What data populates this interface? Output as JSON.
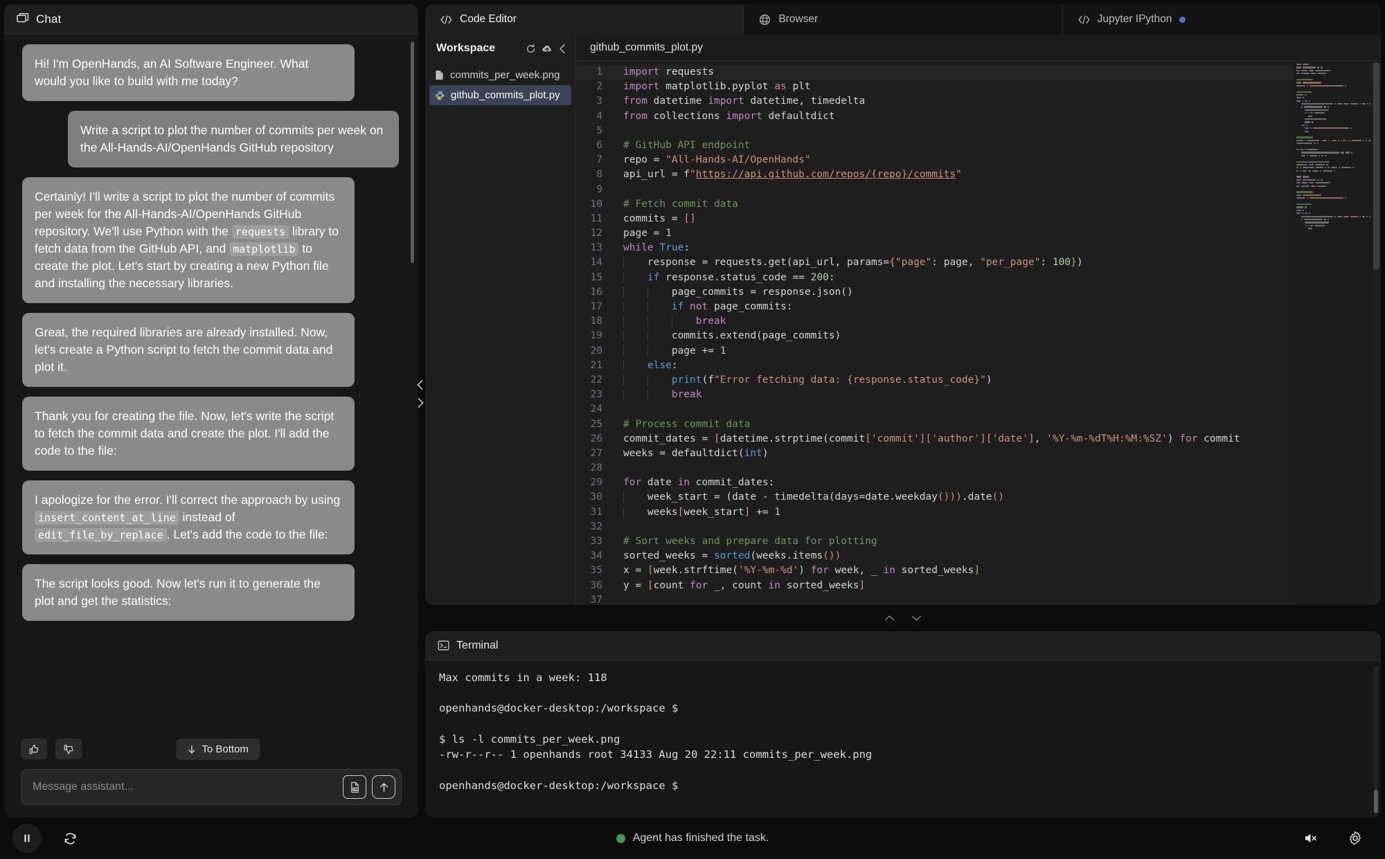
{
  "chat": {
    "header_title": "Chat",
    "header_icon": "chat-bubble-icon",
    "messages": [
      {
        "role": "assistant",
        "text": "Hi! I'm OpenHands, an AI Software Engineer. What would you like to build with me today?"
      },
      {
        "role": "user",
        "text": "Write a script to plot the number of commits per week on the All-Hands-AI/OpenHands GitHub repository"
      },
      {
        "role": "assistant",
        "text": "Certainly! I'll write a script to plot the number of commits per week for the All-Hands-AI/OpenHands GitHub repository. We'll use Python with the ",
        "code1": "requests",
        "text2": " library to fetch data from the GitHub API, and ",
        "code2": "matplotlib",
        "text3": " to create the plot. Let's start by creating a new Python file and installing the necessary libraries."
      },
      {
        "role": "assistant",
        "text": "Great, the required libraries are already installed. Now, let's create a Python script to fetch the commit data and plot it."
      },
      {
        "role": "assistant",
        "text": "Thank you for creating the file. Now, let's write the script to fetch the commit data and create the plot. I'll add the code to the file:"
      },
      {
        "role": "assistant",
        "text": "I apologize for the error. I'll correct the approach by using ",
        "code1": "insert_content_at_line",
        "text2": " instead of ",
        "code2": "edit_file_by_replace",
        "text3": ". Let's add the code to the file:"
      },
      {
        "role": "assistant",
        "text": "The script looks good. Now let's run it to generate the plot and get the statistics:"
      }
    ],
    "thumbs_up_icon": "thumbs-up-icon",
    "thumbs_down_icon": "thumbs-down-icon",
    "to_bottom_label": "To Bottom",
    "to_bottom_arrow": "arrow-down-icon",
    "input_placeholder": "Message assistant...",
    "input_value": "",
    "attach_icon": "attach-image-icon",
    "send_icon": "send-arrow-up-icon"
  },
  "tabs": [
    {
      "label": "Code Editor",
      "icon": "code-brackets-icon",
      "active": true,
      "dot": false
    },
    {
      "label": "Browser",
      "icon": "globe-icon",
      "active": false,
      "dot": false
    },
    {
      "label": "Jupyter IPython",
      "icon": "code-brackets-icon",
      "active": false,
      "dot": true
    }
  ],
  "tab_dot_color": "#4b74d4",
  "workspace": {
    "title": "Workspace",
    "refresh_icon": "refresh-icon",
    "upload_icon": "cloud-upload-icon",
    "collapse_icon": "chevron-left-icon",
    "files": [
      {
        "name": "commits_per_week.png",
        "icon": "file-icon",
        "selected": false
      },
      {
        "name": "github_commits_plot.py",
        "icon": "python-icon",
        "selected": true
      }
    ]
  },
  "editor": {
    "filename": "github_commits_plot.py",
    "current_line": 1,
    "total_lines_shown": 37,
    "lines": [
      {
        "n": 1,
        "indent": 0,
        "tokens": [
          {
            "t": "import",
            "c": "kw2"
          },
          {
            "t": " requests",
            "c": "op"
          }
        ]
      },
      {
        "n": 2,
        "indent": 0,
        "tokens": [
          {
            "t": "import",
            "c": "kw2"
          },
          {
            "t": " matplotlib.pyplot ",
            "c": "op"
          },
          {
            "t": "as",
            "c": "kw2"
          },
          {
            "t": " plt",
            "c": "op"
          }
        ]
      },
      {
        "n": 3,
        "indent": 0,
        "tokens": [
          {
            "t": "from",
            "c": "kw2"
          },
          {
            "t": " datetime ",
            "c": "op"
          },
          {
            "t": "import",
            "c": "kw2"
          },
          {
            "t": " datetime, timedelta",
            "c": "op"
          }
        ]
      },
      {
        "n": 4,
        "indent": 0,
        "tokens": [
          {
            "t": "from",
            "c": "kw2"
          },
          {
            "t": " collections ",
            "c": "op"
          },
          {
            "t": "import",
            "c": "kw2"
          },
          {
            "t": " defaultdict",
            "c": "op"
          }
        ]
      },
      {
        "n": 5,
        "indent": 0,
        "tokens": []
      },
      {
        "n": 6,
        "indent": 0,
        "tokens": [
          {
            "t": "# GitHub API endpoint",
            "c": "cmt"
          }
        ]
      },
      {
        "n": 7,
        "indent": 0,
        "tokens": [
          {
            "t": "repo = ",
            "c": "op"
          },
          {
            "t": "\"All-Hands-AI/OpenHands\"",
            "c": "str"
          }
        ]
      },
      {
        "n": 8,
        "indent": 0,
        "tokens": [
          {
            "t": "api_url = f",
            "c": "op"
          },
          {
            "t": "\"",
            "c": "str"
          },
          {
            "t": "https://api.github.com/repos/{repo}/commits",
            "c": "lnk"
          },
          {
            "t": "\"",
            "c": "str"
          }
        ]
      },
      {
        "n": 9,
        "indent": 0,
        "tokens": []
      },
      {
        "n": 10,
        "indent": 0,
        "tokens": [
          {
            "t": "# Fetch commit data",
            "c": "cmt"
          }
        ]
      },
      {
        "n": 11,
        "indent": 0,
        "tokens": [
          {
            "t": "commits = ",
            "c": "op"
          },
          {
            "t": "[]",
            "c": "str"
          }
        ]
      },
      {
        "n": 12,
        "indent": 0,
        "tokens": [
          {
            "t": "page = ",
            "c": "op"
          },
          {
            "t": "1",
            "c": "num"
          }
        ]
      },
      {
        "n": 13,
        "indent": 0,
        "tokens": [
          {
            "t": "while",
            "c": "kw2"
          },
          {
            "t": " ",
            "c": "op"
          },
          {
            "t": "True",
            "c": "kw"
          },
          {
            "t": ":",
            "c": "op"
          }
        ]
      },
      {
        "n": 14,
        "indent": 1,
        "tokens": [
          {
            "t": "response = requests.get(api_url, params=",
            "c": "op"
          },
          {
            "t": "{",
            "c": "str"
          },
          {
            "t": "\"page\"",
            "c": "str"
          },
          {
            "t": ": page, ",
            "c": "op"
          },
          {
            "t": "\"per_page\"",
            "c": "str"
          },
          {
            "t": ": ",
            "c": "op"
          },
          {
            "t": "100",
            "c": "num"
          },
          {
            "t": "}",
            "c": "str"
          },
          {
            "t": ")",
            "c": "op"
          }
        ]
      },
      {
        "n": 15,
        "indent": 1,
        "tokens": [
          {
            "t": "if",
            "c": "kw"
          },
          {
            "t": " response.status_code == ",
            "c": "op"
          },
          {
            "t": "200",
            "c": "num"
          },
          {
            "t": ":",
            "c": "op"
          }
        ]
      },
      {
        "n": 16,
        "indent": 2,
        "tokens": [
          {
            "t": "page_commits = response.json()",
            "c": "op"
          }
        ]
      },
      {
        "n": 17,
        "indent": 2,
        "tokens": [
          {
            "t": "if",
            "c": "kw"
          },
          {
            "t": " ",
            "c": "op"
          },
          {
            "t": "not",
            "c": "kw2"
          },
          {
            "t": " page_commits:",
            "c": "op"
          }
        ]
      },
      {
        "n": 18,
        "indent": 3,
        "tokens": [
          {
            "t": "break",
            "c": "kw2"
          }
        ]
      },
      {
        "n": 19,
        "indent": 2,
        "tokens": [
          {
            "t": "commits.extend(page_commits)",
            "c": "op"
          }
        ]
      },
      {
        "n": 20,
        "indent": 2,
        "tokens": [
          {
            "t": "page += ",
            "c": "op"
          },
          {
            "t": "1",
            "c": "num"
          }
        ]
      },
      {
        "n": 21,
        "indent": 1,
        "tokens": [
          {
            "t": "else",
            "c": "kw"
          },
          {
            "t": ":",
            "c": "op"
          }
        ]
      },
      {
        "n": 22,
        "indent": 2,
        "tokens": [
          {
            "t": "print",
            "c": "kw"
          },
          {
            "t": "(f",
            "c": "op"
          },
          {
            "t": "\"Error fetching data: {response.status_code}\"",
            "c": "str"
          },
          {
            "t": ")",
            "c": "op"
          }
        ]
      },
      {
        "n": 23,
        "indent": 2,
        "tokens": [
          {
            "t": "break",
            "c": "kw2"
          }
        ]
      },
      {
        "n": 24,
        "indent": 0,
        "tokens": []
      },
      {
        "n": 25,
        "indent": 0,
        "tokens": [
          {
            "t": "# Process commit data",
            "c": "cmt"
          }
        ]
      },
      {
        "n": 26,
        "indent": 0,
        "tokens": [
          {
            "t": "commit_dates = ",
            "c": "op"
          },
          {
            "t": "[",
            "c": "str"
          },
          {
            "t": "datetime.strptime(commit",
            "c": "op"
          },
          {
            "t": "[",
            "c": "str"
          },
          {
            "t": "'commit'",
            "c": "str"
          },
          {
            "t": "]",
            "c": "str"
          },
          {
            "t": "[",
            "c": "str"
          },
          {
            "t": "'author'",
            "c": "str"
          },
          {
            "t": "]",
            "c": "str"
          },
          {
            "t": "[",
            "c": "str"
          },
          {
            "t": "'date'",
            "c": "str"
          },
          {
            "t": "]",
            "c": "str"
          },
          {
            "t": ", ",
            "c": "op"
          },
          {
            "t": "'%Y-%m-%dT%H:%M:%SZ'",
            "c": "str"
          },
          {
            "t": ") ",
            "c": "op"
          },
          {
            "t": "for",
            "c": "kw2"
          },
          {
            "t": " commit",
            "c": "op"
          }
        ]
      },
      {
        "n": 27,
        "indent": 0,
        "tokens": [
          {
            "t": "weeks = defaultdict(",
            "c": "op"
          },
          {
            "t": "int",
            "c": "kw"
          },
          {
            "t": ")",
            "c": "op"
          }
        ]
      },
      {
        "n": 28,
        "indent": 0,
        "tokens": []
      },
      {
        "n": 29,
        "indent": 0,
        "tokens": [
          {
            "t": "for",
            "c": "kw2"
          },
          {
            "t": " date ",
            "c": "op"
          },
          {
            "t": "in",
            "c": "kw2"
          },
          {
            "t": " commit_dates:",
            "c": "op"
          }
        ]
      },
      {
        "n": 30,
        "indent": 1,
        "tokens": [
          {
            "t": "week_start = (date - timedelta(days=date.weekday",
            "c": "op"
          },
          {
            "t": "()))",
            "c": "str"
          },
          {
            "t": ".date",
            "c": "op"
          },
          {
            "t": "()",
            "c": "str"
          }
        ]
      },
      {
        "n": 31,
        "indent": 1,
        "tokens": [
          {
            "t": "weeks",
            "c": "op"
          },
          {
            "t": "[",
            "c": "str"
          },
          {
            "t": "week_start",
            "c": "op"
          },
          {
            "t": "]",
            "c": "str"
          },
          {
            "t": " += ",
            "c": "op"
          },
          {
            "t": "1",
            "c": "num"
          }
        ]
      },
      {
        "n": 32,
        "indent": 0,
        "tokens": []
      },
      {
        "n": 33,
        "indent": 0,
        "tokens": [
          {
            "t": "# Sort weeks and prepare data for plotting",
            "c": "cmt"
          }
        ]
      },
      {
        "n": 34,
        "indent": 0,
        "tokens": [
          {
            "t": "sorted_weeks = ",
            "c": "op"
          },
          {
            "t": "sorted",
            "c": "kw"
          },
          {
            "t": "(weeks.items",
            "c": "op"
          },
          {
            "t": "())",
            "c": "str"
          }
        ]
      },
      {
        "n": 35,
        "indent": 0,
        "tokens": [
          {
            "t": "x = ",
            "c": "op"
          },
          {
            "t": "[",
            "c": "str"
          },
          {
            "t": "week.strftime(",
            "c": "op"
          },
          {
            "t": "'%Y-%m-%d'",
            "c": "str"
          },
          {
            "t": ") ",
            "c": "op"
          },
          {
            "t": "for",
            "c": "kw2"
          },
          {
            "t": " week, _ ",
            "c": "op"
          },
          {
            "t": "in",
            "c": "kw2"
          },
          {
            "t": " sorted_weeks",
            "c": "op"
          },
          {
            "t": "]",
            "c": "str"
          }
        ]
      },
      {
        "n": 36,
        "indent": 0,
        "tokens": [
          {
            "t": "y = ",
            "c": "op"
          },
          {
            "t": "[",
            "c": "str"
          },
          {
            "t": "count ",
            "c": "op"
          },
          {
            "t": "for",
            "c": "kw2"
          },
          {
            "t": " _, count ",
            "c": "op"
          },
          {
            "t": "in",
            "c": "kw2"
          },
          {
            "t": " sorted_weeks",
            "c": "op"
          },
          {
            "t": "]",
            "c": "str"
          }
        ]
      },
      {
        "n": 37,
        "indent": 0,
        "tokens": []
      }
    ],
    "collapse_up_icon": "chevron-up-icon",
    "collapse_down_icon": "chevron-down-icon"
  },
  "terminal": {
    "title": "Terminal",
    "icon": "terminal-icon",
    "lines": [
      "Max commits in a week: 118",
      "",
      "openhands@docker-desktop:/workspace $",
      "",
      "$ ls -l commits_per_week.png",
      "-rw-r--r-- 1 openhands root 34133 Aug 20 22:11 commits_per_week.png",
      "",
      "openhands@docker-desktop:/workspace $"
    ]
  },
  "status_bar": {
    "pause_icon": "pause-icon",
    "refresh_icon": "refresh-icon",
    "status_text": "Agent has finished the task.",
    "status_color": "#3f9a4f",
    "mute_icon": "volume-muted-icon",
    "settings_icon": "gear-icon"
  },
  "divider": {
    "collapse_left_icon": "chevron-left-icon",
    "collapse_right_icon": "chevron-right-icon"
  }
}
